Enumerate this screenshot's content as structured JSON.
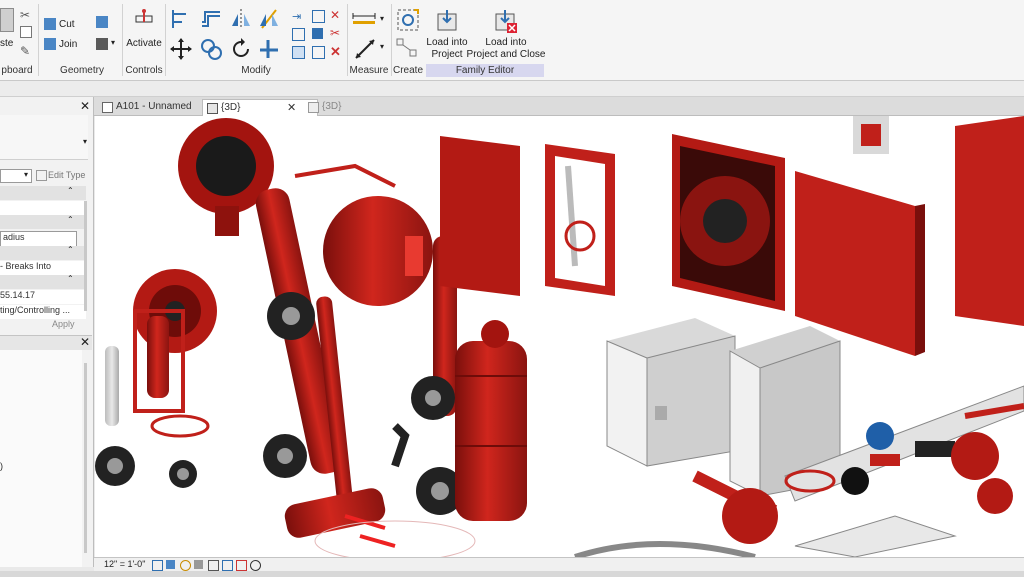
{
  "ribbon": {
    "clipboard": {
      "label": "pboard",
      "paste_label": "ste"
    },
    "geometry": {
      "label": "Geometry",
      "cut_label": "Cut",
      "join_label": "Join"
    },
    "controls": {
      "label": "Controls",
      "activate_label": "Activate"
    },
    "modify": {
      "label": "Modify"
    },
    "measure": {
      "label": "Measure"
    },
    "create": {
      "label": "Create"
    },
    "family_editor": {
      "label": "Family Editor",
      "load_into_project_line1": "Load into",
      "load_into_project_line2": "Project",
      "load_close_line1": "Load into",
      "load_close_line2": "Project and Close"
    }
  },
  "properties": {
    "edit_type": "Edit Type",
    "field_radius": "adius",
    "breaks_into": "- Breaks Into",
    "version_value": "55.14.17",
    "category_value": "ting/Controlling ...",
    "apply_label": "Apply",
    "scroll_item": ")"
  },
  "tabs": [
    {
      "label": "A101 - Unnamed"
    },
    {
      "label": "{3D}"
    },
    {
      "label": "{3D}"
    }
  ],
  "statusbar": {
    "scale": "12\" = 1'-0\""
  },
  "colors": {
    "equipment_red": "#c0201a",
    "cabinet_gray": "#d9d9d9",
    "accent_blue": "#1f5fa8"
  }
}
